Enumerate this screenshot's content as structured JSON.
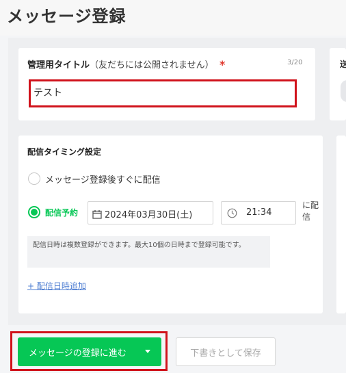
{
  "page": {
    "title": "メッセージ登録"
  },
  "title_field": {
    "label": "管理用タイトル",
    "label_note": "（友だちには公開されません）",
    "required_mark": "*",
    "counter": "3/20",
    "value": "テスト"
  },
  "side_panel": {
    "label_fragment": "送"
  },
  "timing": {
    "title": "配信タイミング設定",
    "option_now": "メッセージ登録後すぐに配信",
    "option_scheduled": "配信予約",
    "selected": "scheduled",
    "date": "2024年03月30日(土)",
    "time": "21:34",
    "suffix": "に配信",
    "note": "配信日時は複数登録ができます。最大10個の日時まで登録可能です。",
    "add_link": "+ 配信日時追加"
  },
  "actions": {
    "submit": "メッセージの登録に進む",
    "draft": "下書きとして保存"
  },
  "colors": {
    "accent": "#06c755",
    "highlight": "#d0121b",
    "required": "#e0352b"
  }
}
